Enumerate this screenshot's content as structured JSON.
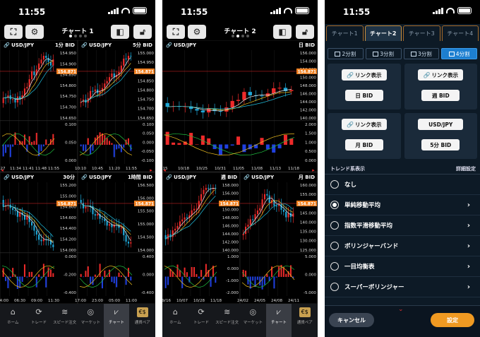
{
  "status": {
    "time": "11:55"
  },
  "colors": {
    "up": "#1ea7d8",
    "down": "#ee2a2a",
    "price_tag": "#f08020",
    "accent": "#1d7fd0",
    "orange": "#f09a22"
  },
  "tabbar": [
    {
      "label": "ホーム",
      "icon": "home-icon",
      "glyph": "⌂"
    },
    {
      "label": "トレード",
      "icon": "trade-icon",
      "glyph": "⟳"
    },
    {
      "label": "スピード注文",
      "icon": "speed-order-icon",
      "glyph": "≋"
    },
    {
      "label": "マーケット",
      "icon": "globe-icon",
      "glyph": "◎"
    },
    {
      "label": "チャート",
      "icon": "chart-icon",
      "glyph": "⩗"
    },
    {
      "label": "通貨ペア",
      "icon": "currency-pair-icon",
      "glyph": "€$"
    }
  ],
  "phone1": {
    "title": "チャート 1",
    "active_dot": 0,
    "panes": [
      {
        "pair": "USD/JPY",
        "tf": "1分",
        "side": "BID",
        "yticks": [
          "154.950",
          "154.900",
          "154.850",
          "154.800",
          "154.750",
          "154.700",
          "154.650"
        ],
        "osc": [
          "0.100",
          "0.050",
          "0.000"
        ],
        "xticks": [
          "27",
          "11:34",
          "11:41",
          "11:48",
          "11:55"
        ],
        "price": "154.871",
        "trend": "up",
        "seed": 3
      },
      {
        "pair": "USD/JPY",
        "tf": "5分",
        "side": "BID",
        "yticks": [
          "155.000",
          "154.950",
          "154.900",
          "154.850",
          "154.800",
          "154.750",
          "154.700",
          "154.650"
        ],
        "osc": [
          "0.100",
          "0.050",
          "0.000",
          "-0.050",
          "-0.100"
        ],
        "xticks": [
          "10:10",
          "10:45",
          "11:20",
          "11:55"
        ],
        "price": "154.871",
        "trend": "up",
        "seed": 7
      },
      {
        "pair": "USD/JPY",
        "tf": "30分",
        "side": "",
        "yticks": [
          "155.200",
          "155.000",
          "154.800",
          "154.600",
          "154.400",
          "154.200",
          "154.000"
        ],
        "osc": [
          "0.000",
          "-0.200",
          "-0.400"
        ],
        "xticks": [
          "04:00",
          "06:30",
          "09:00",
          "11:30"
        ],
        "price": "154.871",
        "trend": "down",
        "seed": 11
      },
      {
        "pair": "USD/JPY",
        "tf": "1時間",
        "side": "BID",
        "yticks": [
          "156.500",
          "156.000",
          "155.500",
          "155.000",
          "154.500",
          "154.000"
        ],
        "osc": [
          "0.400",
          "0.000",
          "-0.400"
        ],
        "xticks": [
          "17:00",
          "23:00",
          "05:00",
          "11:00"
        ],
        "price": "154.871",
        "trend": "down",
        "seed": 19
      }
    ]
  },
  "phone2": {
    "title": "チャート 2",
    "active_dot": 1,
    "panes": [
      {
        "pair": "USD/JPY",
        "tf": "日",
        "side": "BID",
        "yticks": [
          "156.000",
          "154.000",
          "152.000",
          "150.000",
          "148.000",
          "146.000",
          "144.000",
          "142.000",
          "140.000"
        ],
        "osc": [
          "2.000",
          "1.500",
          "1.000",
          "0.500",
          "0.000"
        ],
        "xticks": [
          "15",
          "10/18",
          "10/25",
          "10/31",
          "11/05",
          "11/08",
          "11/13",
          "11/18"
        ],
        "price": "154.871",
        "trend": "up",
        "seed": 23
      },
      {
        "pair": "USD/JPY",
        "tf": "週",
        "side": "BID",
        "yticks": [
          "158.000",
          "156.000",
          "153.000",
          "150.000",
          "148.000",
          "146.000",
          "144.000",
          "142.000",
          "140.000"
        ],
        "osc": [
          "1.000",
          "0.000",
          "-1.000",
          "-2.000"
        ],
        "xticks": [
          "09/16",
          "10/07",
          "10/28",
          "11/18"
        ],
        "price": "154.871",
        "trend": "up",
        "seed": 29
      },
      {
        "pair": "USD/JPY",
        "tf": "月",
        "side": "BID",
        "yticks": [
          "160.000",
          "155.000",
          "150.000",
          "145.000",
          "140.000",
          "135.000",
          "130.000",
          "125.000"
        ],
        "osc": [
          "5.000",
          "0.000",
          "-5.000"
        ],
        "xticks": [
          "24/02",
          "24/05",
          "24/08",
          "24/11"
        ],
        "price": "154.871",
        "trend": "mixed",
        "seed": 31
      }
    ]
  },
  "settings": {
    "chart_tabs": [
      "チャート1",
      "チャート2",
      "チャート3",
      "チャート4"
    ],
    "active_tab": 1,
    "split_buttons": [
      "2分割",
      "3分割",
      "3分割",
      "4分割"
    ],
    "active_split": 3,
    "cells": [
      {
        "link": "リンク表示",
        "sub": "日 BID"
      },
      {
        "link": "リンク表示",
        "sub": "週 BID"
      },
      {
        "link": "リンク表示",
        "sub": "月 BID"
      },
      {
        "link": "USD/JPY",
        "sub": "5分 BID"
      }
    ],
    "trend_header": "トレンド系表示",
    "detail_settings": "詳細設定",
    "trend_items": [
      {
        "label": "なし",
        "selected": false,
        "chevron": false
      },
      {
        "label": "単純移動平均",
        "selected": true,
        "chevron": true
      },
      {
        "label": "指数平滑移動平均",
        "selected": false,
        "chevron": true
      },
      {
        "label": "ボリンジャーバンド",
        "selected": false,
        "chevron": true
      },
      {
        "label": "一目均衡表",
        "selected": false,
        "chevron": true
      },
      {
        "label": "スーパーボリンジャー",
        "selected": false,
        "chevron": true
      }
    ],
    "cancel_label": "キャンセル",
    "ok_label": "設定"
  }
}
